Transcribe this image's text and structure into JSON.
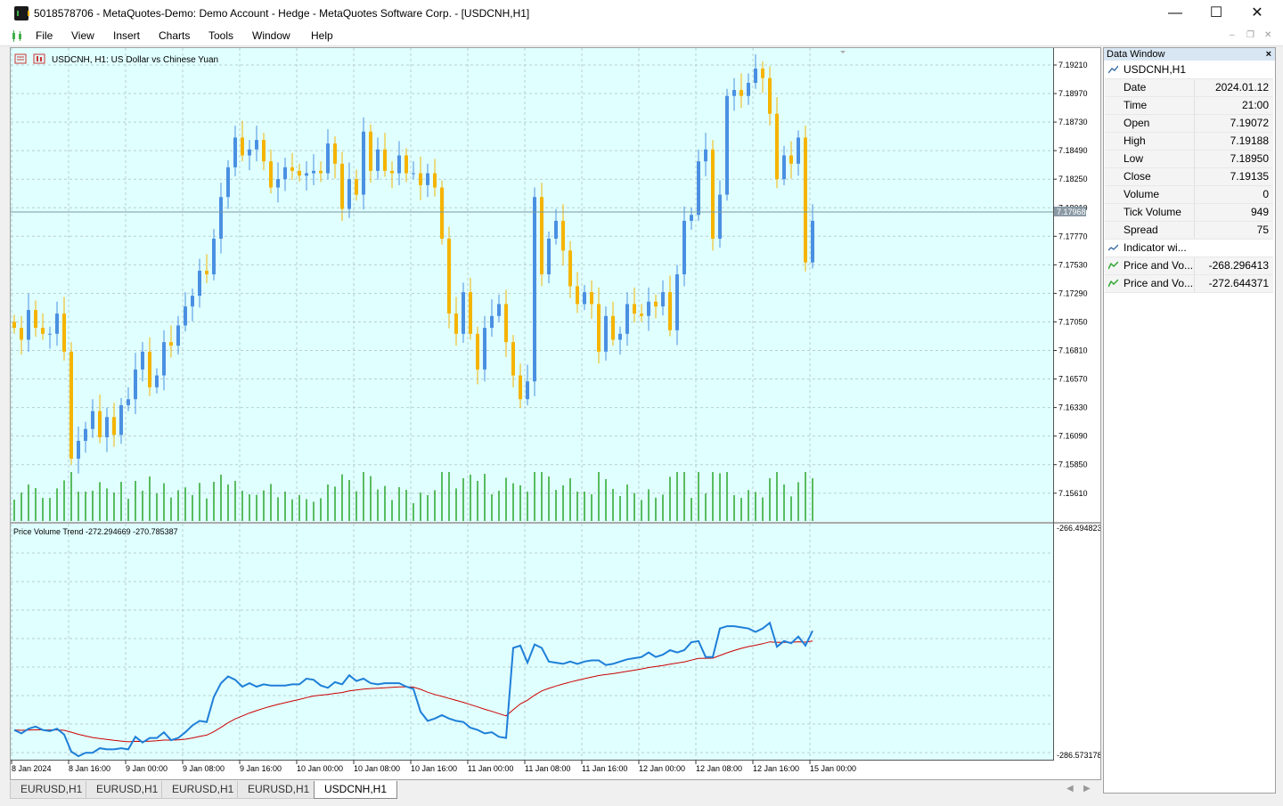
{
  "window": {
    "title": "5018578706 - MetaQuotes-Demo: Demo Account - Hedge - MetaQuotes Software Corp. - [USDCNH,H1]",
    "controls": [
      "—",
      "☐",
      "✕"
    ]
  },
  "menu": [
    "File",
    "View",
    "Insert",
    "Charts",
    "Tools",
    "Window",
    "Help"
  ],
  "chart": {
    "header": "USDCNH, H1:  US Dollar vs Chinese Yuan",
    "current_price": "7.17968",
    "price_ticks": [
      "7.19210",
      "7.18970",
      "7.18730",
      "7.18490",
      "7.18250",
      "7.18010",
      "7.17770",
      "7.17530",
      "7.17290",
      "7.17050",
      "7.16810",
      "7.16570",
      "7.16330",
      "7.16090",
      "7.15850",
      "7.15610"
    ],
    "indicator_label": "Price Volume Trend -272.294669 -270.785387",
    "indicator_ticks": [
      "-266.494823",
      "-286.573178"
    ],
    "time_labels": [
      "8 Jan 2024",
      "8 Jan 16:00",
      "9 Jan 00:00",
      "9 Jan 08:00",
      "9 Jan 16:00",
      "10 Jan 00:00",
      "10 Jan 08:00",
      "10 Jan 16:00",
      "11 Jan 00:00",
      "11 Jan 08:00",
      "11 Jan 16:00",
      "12 Jan 00:00",
      "12 Jan 08:00",
      "12 Jan 16:00",
      "15 Jan 00:00"
    ],
    "colors": {
      "bg": "#e0ffff",
      "bull": "#4a90e2",
      "bear": "#f5b400",
      "volume": "#2aa52a",
      "pvt": "#1e7fd8",
      "signal": "#cc0000"
    }
  },
  "tabs": [
    "EURUSD,H1",
    "EURUSD,H1",
    "EURUSD,H1",
    "EURUSD,H1",
    "USDCNH,H1"
  ],
  "active_tab": 4,
  "data_window": {
    "title": "Data Window",
    "close": "×",
    "symbol": "USDCNH,H1",
    "rows": [
      {
        "k": "Date",
        "v": "2024.01.12"
      },
      {
        "k": "Time",
        "v": "21:00"
      },
      {
        "k": "Open",
        "v": "7.19072"
      },
      {
        "k": "High",
        "v": "7.19188"
      },
      {
        "k": "Low",
        "v": "7.18950"
      },
      {
        "k": "Close",
        "v": "7.19135"
      },
      {
        "k": "Volume",
        "v": "0"
      },
      {
        "k": "Tick Volume",
        "v": "949"
      },
      {
        "k": "Spread",
        "v": "75"
      }
    ],
    "indicator_header": "Indicator wi...",
    "indicator_rows": [
      {
        "k": "Price and Vo...",
        "v": "-268.296413"
      },
      {
        "k": "Price and Vo...",
        "v": "-272.644371"
      }
    ]
  },
  "chart_data": {
    "type": "candlestick",
    "closes": [
      7.17,
      7.169,
      7.1715,
      7.17,
      7.1695,
      7.1695,
      7.1712,
      7.168,
      7.159,
      7.1605,
      7.1615,
      7.163,
      7.1608,
      7.1625,
      7.161,
      7.1635,
      7.164,
      7.1665,
      7.168,
      7.165,
      7.166,
      7.1688,
      7.1685,
      7.1702,
      7.1718,
      7.1727,
      7.1748,
      7.1745,
      7.1775,
      7.181,
      7.1835,
      7.186,
      7.1845,
      7.185,
      7.1858,
      7.184,
      7.1818,
      7.1825,
      7.1835,
      7.1832,
      7.1828,
      7.183,
      7.1832,
      7.183,
      7.1855,
      7.1838,
      7.18,
      7.1825,
      7.1812,
      7.1865,
      7.1832,
      7.185,
      7.1832,
      7.183,
      7.1845,
      7.183,
      7.183,
      7.182,
      7.183,
      7.1818,
      7.1775,
      7.1712,
      7.1695,
      7.173,
      7.1695,
      7.1665,
      7.17,
      7.171,
      7.172,
      7.1688,
      7.166,
      7.164,
      7.1655,
      7.181,
      7.1745,
      7.1775,
      7.179,
      7.1765,
      7.1735,
      7.172,
      7.173,
      7.172,
      7.168,
      7.171,
      7.169,
      7.1695,
      7.172,
      7.1712,
      7.171,
      7.1722,
      7.1718,
      7.173,
      7.1698,
      7.1745,
      7.179,
      7.1795,
      7.184,
      7.185,
      7.1775,
      7.1812,
      7.1895,
      7.19,
      7.1895,
      7.1906,
      7.1918,
      7.191,
      7.188,
      7.1825,
      7.1845,
      7.1838,
      7.186,
      7.1755,
      7.179
    ],
    "pvt": [
      -284.2,
      -284.5,
      -284.1,
      -283.9,
      -284.2,
      -284.3,
      -284.1,
      -284.6,
      -286.1,
      -286.5,
      -286.2,
      -286.2,
      -285.8,
      -285.9,
      -285.9,
      -285.8,
      -285.9,
      -284.8,
      -285.3,
      -284.9,
      -284.9,
      -284.4,
      -285.1,
      -284.9,
      -284.4,
      -283.8,
      -283.4,
      -283.5,
      -281.3,
      -280.1,
      -279.5,
      -279.8,
      -280.4,
      -280.1,
      -280.4,
      -280.2,
      -280.3,
      -280.3,
      -280.3,
      -280.2,
      -280.2,
      -279.7,
      -279.8,
      -280.3,
      -280.5,
      -280.0,
      -280.2,
      -279.4,
      -279.9,
      -279.7,
      -280.1,
      -280.2,
      -280.1,
      -280.1,
      -280.1,
      -280.4,
      -280.6,
      -282.6,
      -283.4,
      -283.2,
      -282.9,
      -283.2,
      -283.4,
      -283.5,
      -284.0,
      -284.2,
      -284.5,
      -284.4,
      -284.8,
      -284.9,
      -277.0,
      -276.8,
      -278.3,
      -276.7,
      -277.0,
      -278.2,
      -278.3,
      -278.4,
      -278.2,
      -278.4,
      -278.2,
      -278.1,
      -278.1,
      -278.5,
      -278.4,
      -278.2,
      -278.0,
      -277.9,
      -277.8,
      -277.4,
      -277.8,
      -277.6,
      -277.2,
      -277.4,
      -277.2,
      -276.5,
      -276.4,
      -277.8,
      -277.8,
      -275.3,
      -275.1,
      -275.1,
      -275.2,
      -275.3,
      -275.6,
      -275.3,
      -274.8,
      -276.9,
      -276.4,
      -276.6,
      -276.0,
      -276.8,
      -275.5
    ],
    "pvt_ylim": [
      -286.573178,
      -266.494823
    ]
  }
}
